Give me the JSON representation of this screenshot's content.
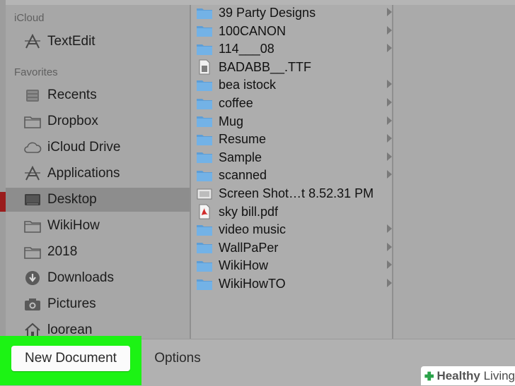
{
  "sidebar": {
    "icloud_header": "iCloud",
    "icloud_items": [
      {
        "label": "TextEdit",
        "icon": "textedit-icon"
      }
    ],
    "favorites_header": "Favorites",
    "favorites_items": [
      {
        "label": "Recents",
        "icon": "recents-icon"
      },
      {
        "label": "Dropbox",
        "icon": "folder-icon"
      },
      {
        "label": "iCloud Drive",
        "icon": "cloud-icon"
      },
      {
        "label": "Applications",
        "icon": "applications-icon"
      },
      {
        "label": "Desktop",
        "icon": "desktop-icon",
        "selected": true
      },
      {
        "label": "WikiHow",
        "icon": "folder-icon"
      },
      {
        "label": "2018",
        "icon": "folder-icon"
      },
      {
        "label": "Downloads",
        "icon": "downloads-icon"
      },
      {
        "label": "Pictures",
        "icon": "camera-icon"
      },
      {
        "label": "loorean",
        "icon": "home-icon"
      }
    ]
  },
  "files": [
    {
      "name": "39 Party Designs",
      "kind": "folder"
    },
    {
      "name": "100CANON",
      "kind": "folder"
    },
    {
      "name": "114___08",
      "kind": "folder"
    },
    {
      "name": "BADABB__.TTF",
      "kind": "font"
    },
    {
      "name": "bea istock",
      "kind": "folder"
    },
    {
      "name": "coffee",
      "kind": "folder"
    },
    {
      "name": "Mug",
      "kind": "folder"
    },
    {
      "name": "Resume",
      "kind": "folder"
    },
    {
      "name": "Sample",
      "kind": "folder"
    },
    {
      "name": "scanned",
      "kind": "folder"
    },
    {
      "name": "Screen Shot…t 8.52.31 PM",
      "kind": "image"
    },
    {
      "name": "sky bill.pdf",
      "kind": "pdf"
    },
    {
      "name": "video music",
      "kind": "folder"
    },
    {
      "name": "WallPaPer",
      "kind": "folder"
    },
    {
      "name": "WikiHow",
      "kind": "folder"
    },
    {
      "name": "WikiHowTO",
      "kind": "folder"
    }
  ],
  "buttons": {
    "new_document": "New Document",
    "options": "Options"
  },
  "watermark": {
    "brand_bold": "Healthy",
    "brand_rest": " Living"
  },
  "colors": {
    "highlight": "#1cf314",
    "folder": "#5e9ed6",
    "selected_row": "#8d8d8d"
  }
}
